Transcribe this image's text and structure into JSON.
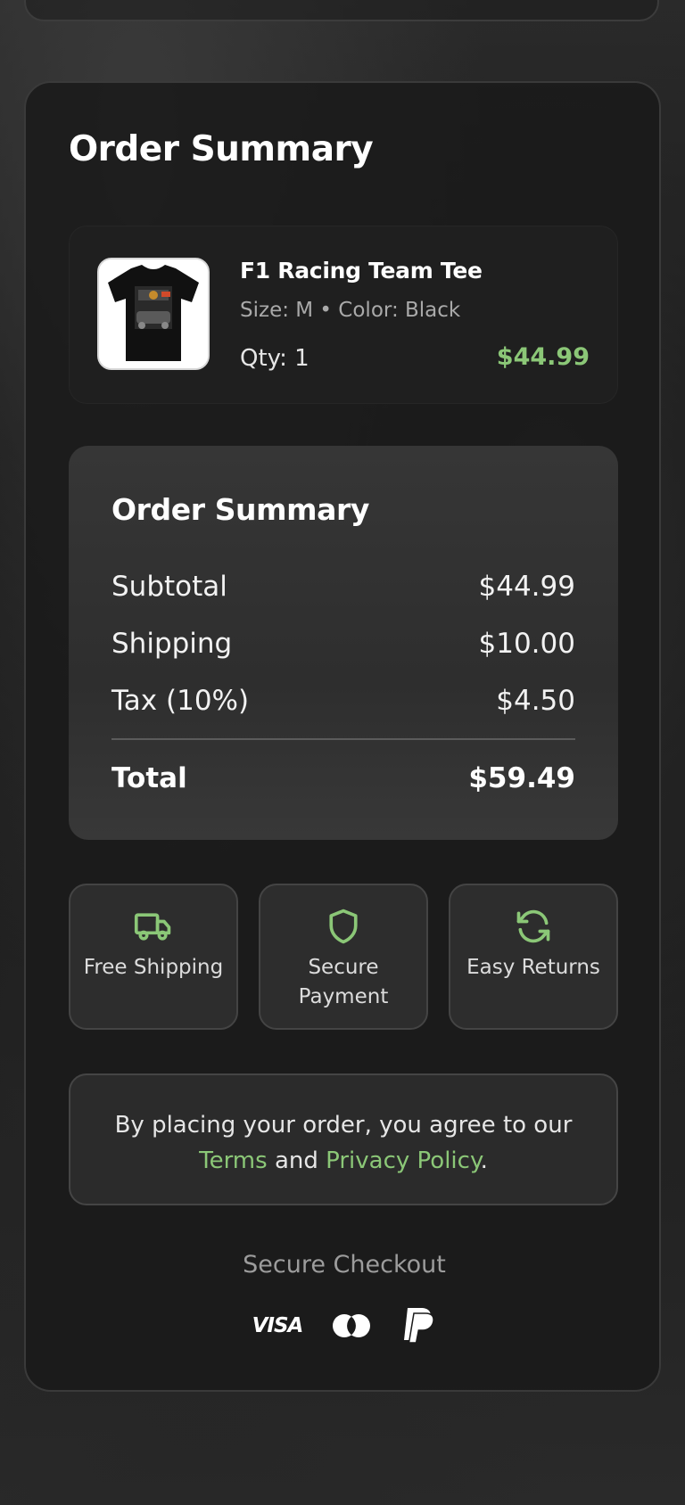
{
  "page": {
    "title": "Order Summary"
  },
  "product": {
    "name": "F1 Racing Team Tee",
    "meta": "Size: M • Color: Black",
    "qty": "Qty: 1",
    "price": "$44.99",
    "image_icon": "t-shirt-image"
  },
  "summary": {
    "title": "Order Summary",
    "rows": [
      {
        "label": "Subtotal",
        "value": "$44.99"
      },
      {
        "label": "Shipping",
        "value": "$10.00"
      },
      {
        "label": "Tax (10%)",
        "value": "$4.50"
      }
    ],
    "total_label": "Total",
    "total_value": "$59.49"
  },
  "features": [
    {
      "icon": "truck-icon",
      "label": "Free Shipping"
    },
    {
      "icon": "shield-icon",
      "label": "Secure Payment"
    },
    {
      "icon": "refresh-icon",
      "label": "Easy Returns"
    }
  ],
  "terms": {
    "prefix": "By placing your order, you agree to our",
    "terms_link": "Terms",
    "and": "and",
    "privacy_link": "Privacy Policy",
    "suffix": "."
  },
  "checkout": {
    "label": "Secure Checkout",
    "visa_text": "VISA",
    "methods": [
      "visa-icon",
      "mastercard-icon",
      "paypal-icon"
    ]
  },
  "colors": {
    "accent": "#8bc777",
    "panel": "#1a1a1a",
    "card": "#2d2d2d"
  }
}
